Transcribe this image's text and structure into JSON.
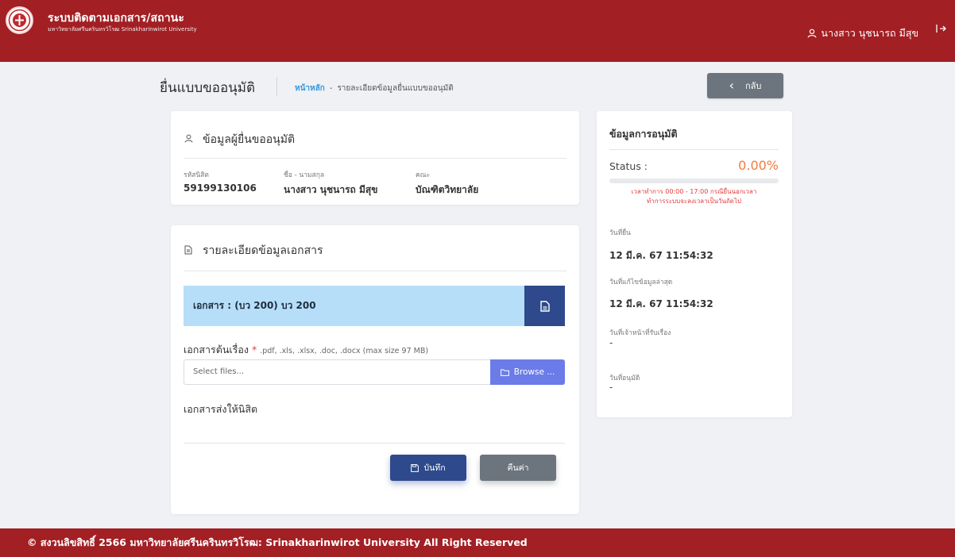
{
  "header": {
    "app_title": "ระบบติดตามเอกสาร/สถานะ",
    "app_subtitle": "มหาวิทยาลัยศรีนครินทรวิโรฒ Srinakharinwirot University",
    "user_name": "นางสาว นุชนารถ มีสุข",
    "logo_icon": "university-seal-icon",
    "colors": {
      "brand": "#a21f24"
    }
  },
  "page": {
    "title": "ยื่นแบบขออนุมัติ",
    "breadcrumb": {
      "home": "หน้าหลัก",
      "separator": "-",
      "current": "รายละเอียดข้อมูลยื่นแบบขออนุมัติ"
    },
    "back_label": "กลับ"
  },
  "applicant": {
    "heading": "ข้อมูลผู้ยื่นขออนุมัติ",
    "fields": [
      {
        "label": "รหัสนิสิต",
        "value": "59199130106"
      },
      {
        "label": "ชื่อ - นามสกุล",
        "value": "นางสาว นุชนารถ มีสุข"
      },
      {
        "label": "คณะ",
        "value": "บัณฑิตวิทยาลัย"
      }
    ]
  },
  "document": {
    "heading": "รายละเอียดข้อมูลเอกสาร",
    "doc_title": "เอกสาร : (บว 200) บว 200",
    "upload_label": "เอกสารต้นเรื่อง",
    "required_mark": "*",
    "upload_hint": ".pdf, .xls, .xlsx, .doc, .docx (max size 97 MB)",
    "file_placeholder": "Select files...",
    "browse_label": "Browse ...",
    "sent_label": "เอกสารส่งให้นิสิต",
    "save_label": "บันทึก",
    "reset_label": "คืนค่า"
  },
  "approval": {
    "heading": "ข้อมูลการอนุมัติ",
    "status_label": "Status :",
    "status_value": "0.00%",
    "progress": 0,
    "notice_line1": "เวลาทำการ 00:00 - 17:00 กรณียื่นนอกเวลา",
    "notice_line2": "ทำการระบบจะลงเวลาเป็นวันถัดไป",
    "submitted_label": "วันที่ยื่น",
    "submitted_value": "12 มี.ค. 67 11:54:32",
    "updated_label": "วันที่แก้ไขข้อมูลล่าสุด",
    "updated_value": "12 มี.ค. 67 11:54:32",
    "received_label": "วันที่เจ้าหน้าที่รับเรื่อง",
    "received_value": "-",
    "approved_label": "วันที่อนุมัติ",
    "approved_value": "-",
    "colors": {
      "status": "#f07b3f",
      "notice": "#e23b3b"
    }
  },
  "footer": {
    "text": "© สงวนลิขสิทธิ์ 2566 มหาวิทยาลัยศรีนครินทรวิโรฒ: Srinakharinwirot University All Right Reserved"
  }
}
